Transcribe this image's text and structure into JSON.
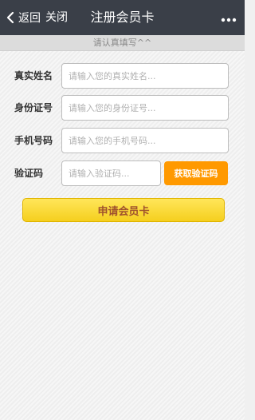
{
  "navbar": {
    "back_label": "返回",
    "close_label": "关闭",
    "title": "注册会员卡",
    "more_icon": "more-dots-icon",
    "back_icon": "chevron-left-icon",
    "background": "#3a3f48"
  },
  "notice": {
    "text": "请认真填写^^"
  },
  "form": {
    "name": {
      "label": "真实姓名",
      "placeholder": "请输入您的真实姓名..."
    },
    "id_number": {
      "label": "身份证号",
      "placeholder": "请输入您的身份证号..."
    },
    "phone": {
      "label": "手机号码",
      "placeholder": "请输入您的手机号码..."
    },
    "code": {
      "label": "验证码",
      "placeholder": "请输入验证码...",
      "button_label": "获取验证码"
    },
    "submit_label": "申请会员卡"
  },
  "colors": {
    "get_code_button": "#ff9900",
    "submit_button": "#f5cf1e",
    "submit_text": "#a0522d"
  }
}
